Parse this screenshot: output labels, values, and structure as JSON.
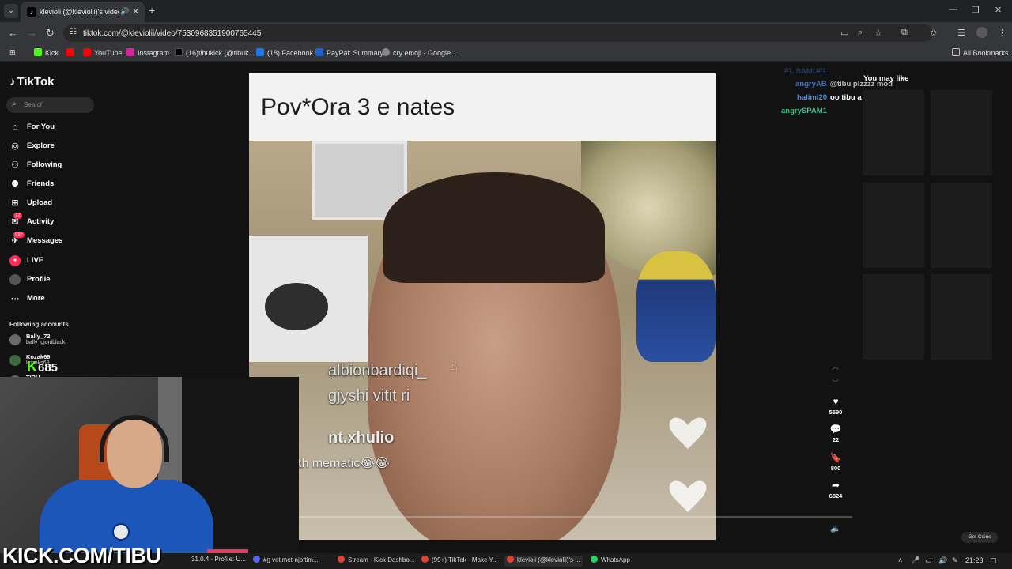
{
  "browser": {
    "tab_title": "klevioli (@kleviolii)'s video",
    "url": "tiktok.com/@kleviolii/video/7530968351900765445",
    "bookmarks": [
      {
        "label": "Kick",
        "color": "#53fc18"
      },
      {
        "label": "YouTube",
        "color": "#ff0000"
      },
      {
        "label": "Instagram",
        "color": "#d6249f"
      },
      {
        "label": "(16)tibukick (@tibuk...",
        "color": "#000000"
      },
      {
        "label": "(18) Facebook",
        "color": "#1877f2"
      },
      {
        "label": "PayPal: Summary",
        "color": "#1f62c8"
      },
      {
        "label": "cry emoji - Google...",
        "color": "#888888"
      }
    ],
    "all_bookmarks": "All Bookmarks"
  },
  "tiktok": {
    "logo": "TikTok",
    "search_placeholder": "Search",
    "nav": [
      {
        "label": "For You",
        "icon": "home-icon"
      },
      {
        "label": "Explore",
        "icon": "compass-icon"
      },
      {
        "label": "Following",
        "icon": "following-icon"
      },
      {
        "label": "Friends",
        "icon": "friends-icon"
      },
      {
        "label": "Upload",
        "icon": "upload-icon"
      },
      {
        "label": "Activity",
        "icon": "activity-icon",
        "badge": "72"
      },
      {
        "label": "Messages",
        "icon": "messages-icon",
        "badge": "99+"
      },
      {
        "label": "LIVE",
        "icon": "live-icon"
      },
      {
        "label": "Profile",
        "icon": "profile-icon"
      },
      {
        "label": "More",
        "icon": "more-icon"
      }
    ],
    "following_title": "Following accounts",
    "following": [
      {
        "name": "Bally_72",
        "handle": "bally_gjoniblack"
      },
      {
        "name": "Kozak69",
        "handle": "kozaks69"
      },
      {
        "name": "TIBU",
        "handle": ""
      }
    ],
    "video_caption": "Pov*Ora 3 e nates",
    "video_overlays": [
      {
        "text": "albionbardiqi_"
      },
      {
        "text": "gjyshi vitit ri"
      },
      {
        "text": "nt.xhulio"
      },
      {
        "text": "th mematic😂😂"
      }
    ],
    "likes": "5590",
    "comments": "22",
    "saves": "800",
    "shares": "6824",
    "you_may_like": "You may like",
    "get_coins": "Get Coins",
    "progress": 0.0
  },
  "stream": {
    "chat": [
      {
        "user": "EL SAMUEL",
        "text": "",
        "color": "#3b5fb3"
      },
      {
        "user": "angryAB",
        "text": "@tibu plzzzz mod",
        "color": "#4a6db5"
      },
      {
        "user": "halimi20",
        "text": "oo tibu a vejn scrims",
        "color": "#4a8fe0"
      },
      {
        "user": "angrySPAM1",
        "text": "",
        "color": "#39c28b"
      }
    ],
    "viewer_count": "685",
    "banner": "KICK.COM/TIBU"
  },
  "taskbar": [
    {
      "label": "31.0.4 - Profile: U...",
      "color": "#777777"
    },
    {
      "label": "#▯ votimet-njoftim...",
      "color": "#5865f2"
    },
    {
      "label": "Stream - Kick Dashbo...",
      "color": "#e34133"
    },
    {
      "label": "(99+) TikTok - Make Y...",
      "color": "#e34133"
    },
    {
      "label": "klevioli (@kleviolii)'s ...",
      "color": "#e34133"
    },
    {
      "label": "WhatsApp",
      "color": "#25d366"
    }
  ],
  "clock": "21:23"
}
